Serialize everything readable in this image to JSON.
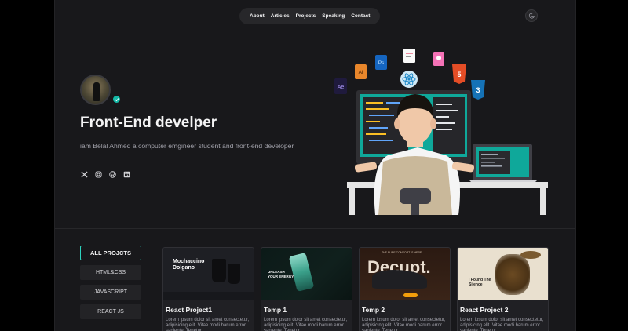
{
  "nav": {
    "items": [
      "About",
      "Articles",
      "Projects",
      "Speaking",
      "Contact"
    ]
  },
  "theme_toggle": {
    "icon": "moon-icon"
  },
  "hero": {
    "title": "Front-End develper",
    "description": "iam Belal Ahmed a computer emgineer student and front-end developer",
    "socials": [
      "x-icon",
      "instagram-icon",
      "github-icon",
      "linkedin-icon"
    ]
  },
  "illustration": {
    "badges": [
      "Ae",
      "Ai",
      "Ps",
      "5",
      "3"
    ]
  },
  "filters": [
    "ALL PROJCTS",
    "HTML&CSS",
    "JAVASCRIPT",
    "REACT JS"
  ],
  "cards": [
    {
      "title": "React Project1",
      "thumb_heading": "Mochaccino Dolgano",
      "desc": "Lorem ipsum dolor sit amet consectetur, adipisicing elit. Vitae modi harum error sapiente. Tenetur"
    },
    {
      "title": "Temp 1",
      "thumb_heading": "UNLEASH YOUR ENERGY",
      "desc": "Lorem ipsum dolor sit amet consectetur, adipisicing elit. Vitae modi harum error sapiente. Tenetur"
    },
    {
      "title": "Temp 2",
      "thumb_heading": "Deçupt.",
      "thumb_sub": "THE PURE COMFORT IS HERE",
      "desc": "Lorem ipsum dolor sit amet consectetur, adipisicing elit. Vitae modi harum error sapiente. Tenetur"
    },
    {
      "title": "React Project 2",
      "thumb_heading": "I Found The Silence",
      "desc": "Lorem ipsum dolor sit amet consectetur, adipisicing elit. Vitae modi harum error sapiente. Tenetur"
    }
  ],
  "colors": {
    "accent": "#2dd4bf",
    "background": "#18181b",
    "outer": "#000000"
  }
}
